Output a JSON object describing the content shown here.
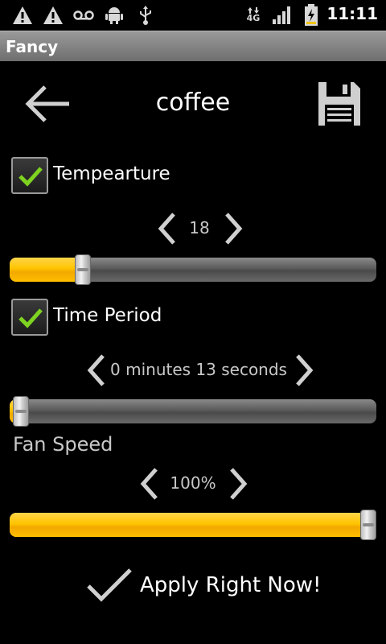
{
  "status_bar": {
    "icons": [
      "warning-icon",
      "warning-icon",
      "voicemail-icon",
      "android-icon",
      "usb-icon",
      "4g-data-icon",
      "signal-icon",
      "battery-charging-icon"
    ],
    "network": "4G",
    "time": "11:11"
  },
  "app": {
    "title": "Fancy"
  },
  "header": {
    "record_name": "coffee",
    "back_icon": "back-arrow-icon",
    "save_icon": "floppy-disk-icon"
  },
  "temperature": {
    "label": "Tempearture",
    "checked": true,
    "value": "18",
    "slider_fraction": 0.2
  },
  "time_period": {
    "label": "Time Period",
    "checked": true,
    "value": "0 minutes 13 seconds",
    "slider_fraction": 0.03
  },
  "fan_speed": {
    "label": "Fan Speed",
    "value": "100%",
    "slider_fraction": 1.0
  },
  "apply": {
    "label": "Apply Right Now!"
  },
  "colors": {
    "accent": "#ffc400",
    "check_green": "#7ed321"
  }
}
